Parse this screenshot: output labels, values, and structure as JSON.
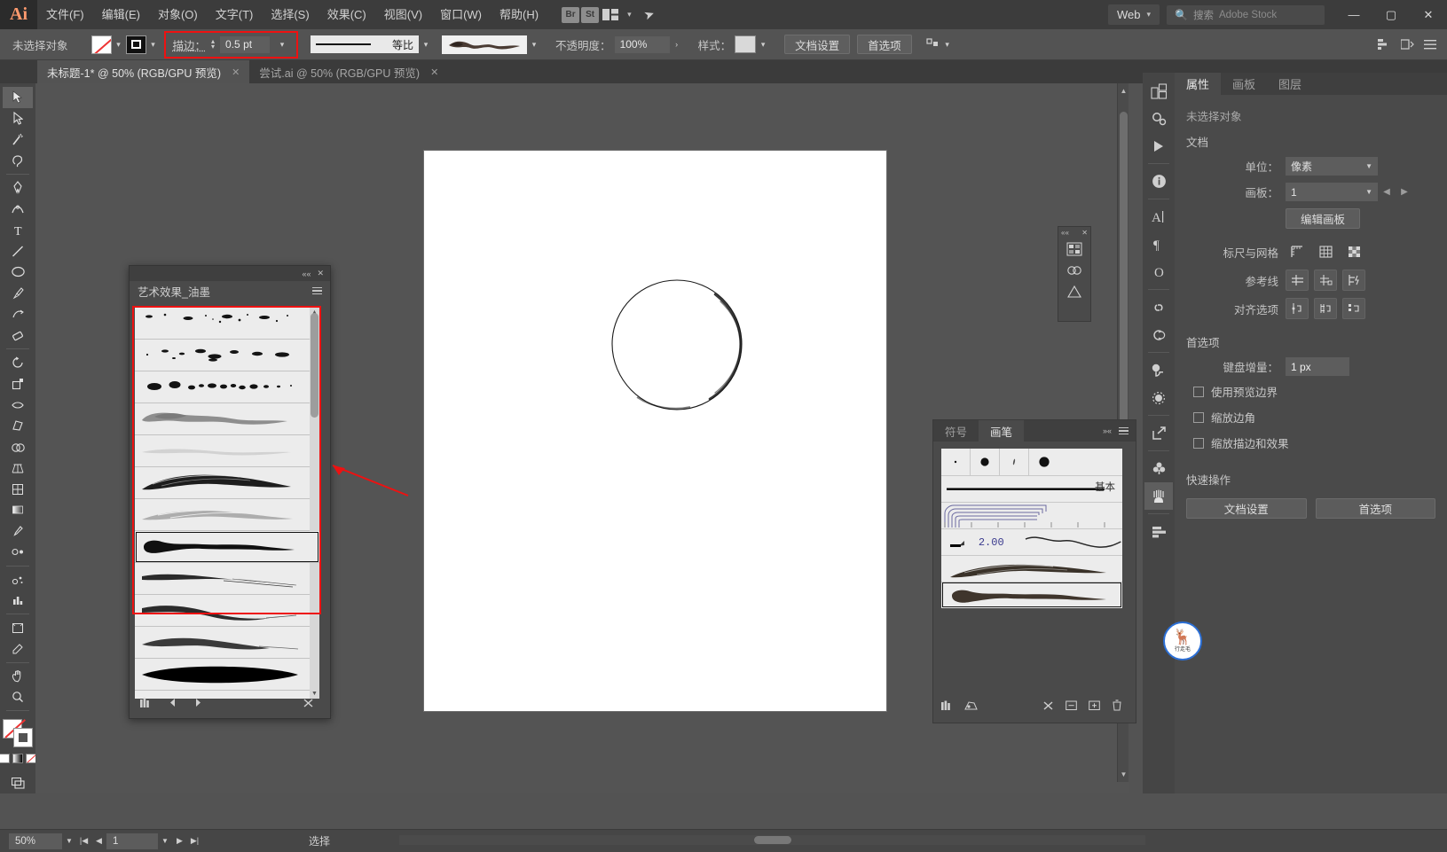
{
  "app": {
    "logo": "Ai",
    "title": "Adobe Illustrator"
  },
  "menubar": {
    "items": [
      {
        "label": "文件(F)"
      },
      {
        "label": "编辑(E)"
      },
      {
        "label": "对象(O)"
      },
      {
        "label": "文字(T)"
      },
      {
        "label": "选择(S)"
      },
      {
        "label": "效果(C)"
      },
      {
        "label": "视图(V)"
      },
      {
        "label": "窗口(W)"
      },
      {
        "label": "帮助(H)"
      }
    ],
    "bridge_label": "Br",
    "stock_label": "St",
    "workspace": "Web",
    "search_placeholder": "搜索 Adobe Stock",
    "search_label": "搜索",
    "search_hint": "Adobe Stock",
    "window_minimize": "—",
    "window_maximize": "▢",
    "window_close": "✕"
  },
  "controlbar": {
    "selection_status": "未选择对象",
    "stroke_label": "描边：",
    "stroke_weight": "0.5 pt",
    "profile_label": "等比",
    "opacity_label": "不透明度：",
    "opacity_value": "100%",
    "style_label": "样式：",
    "doc_setup": "文档设置",
    "preferences": "首选项",
    "highlight_color": "#ee1111"
  },
  "tabs": [
    {
      "label": "未标题-1* @ 50% (RGB/GPU 预览)",
      "active": true,
      "close": "✕"
    },
    {
      "label": "尝试.ai @ 50% (RGB/GPU 预览)",
      "active": false,
      "close": "✕"
    }
  ],
  "toolbar": {
    "tools": [
      {
        "name": "selection-tool"
      },
      {
        "name": "direct-selection-tool"
      },
      {
        "name": "magic-wand-tool"
      },
      {
        "name": "lasso-tool"
      },
      {
        "name": "pen-tool"
      },
      {
        "name": "curvature-tool"
      },
      {
        "name": "type-tool"
      },
      {
        "name": "line-segment-tool"
      },
      {
        "name": "ellipse-tool"
      },
      {
        "name": "paintbrush-tool"
      },
      {
        "name": "shaper-tool"
      },
      {
        "name": "eraser-tool"
      },
      {
        "name": "rotate-tool"
      },
      {
        "name": "scale-tool"
      },
      {
        "name": "width-tool"
      },
      {
        "name": "free-transform-tool"
      },
      {
        "name": "shape-builder-tool"
      },
      {
        "name": "perspective-grid-tool"
      },
      {
        "name": "mesh-tool"
      },
      {
        "name": "gradient-tool"
      },
      {
        "name": "eyedropper-tool"
      },
      {
        "name": "blend-tool"
      },
      {
        "name": "symbol-sprayer-tool"
      },
      {
        "name": "column-graph-tool"
      },
      {
        "name": "artboard-tool"
      },
      {
        "name": "slice-tool"
      },
      {
        "name": "hand-tool"
      },
      {
        "name": "zoom-tool"
      }
    ]
  },
  "canvas": {
    "artboard_background": "#ffffff",
    "shape": "circle-with-ink-brush-stroke"
  },
  "brush_library_panel": {
    "title": "艺术效果_油墨",
    "collapse": "««",
    "close": "✕",
    "menu": "menu",
    "brushes": [
      {
        "name": "ink-splatter-1",
        "style": "splatter-small"
      },
      {
        "name": "ink-splatter-2",
        "style": "splatter-dots"
      },
      {
        "name": "ink-splatter-3",
        "style": "splatter-blobs"
      },
      {
        "name": "ink-wash-gray",
        "style": "wash-gray"
      },
      {
        "name": "ink-wash-light",
        "style": "wash-light"
      },
      {
        "name": "ink-dry-brush-dark",
        "style": "dry-brush-dark"
      },
      {
        "name": "ink-dry-brush-light",
        "style": "dry-brush-light"
      },
      {
        "name": "ink-thick-tapered",
        "style": "thick-tapered",
        "selected": true
      },
      {
        "name": "ink-stroke-fade-1",
        "style": "stroke-fade"
      },
      {
        "name": "ink-stroke-wave",
        "style": "stroke-wave"
      },
      {
        "name": "ink-stroke-fade-2",
        "style": "stroke-fade2"
      },
      {
        "name": "ink-solid-lens",
        "style": "solid-lens"
      },
      {
        "name": "ink-solid-taper",
        "style": "solid-taper"
      },
      {
        "name": "ink-solid-wedge",
        "style": "solid-wedge"
      }
    ],
    "footer_icons": [
      "library-icon",
      "prev-icon",
      "next-icon",
      "delete-icon"
    ],
    "annotation_box_color": "#ee1111"
  },
  "brushes_panel": {
    "tabs": [
      {
        "label": "符号",
        "active": false
      },
      {
        "label": "画笔",
        "active": true
      }
    ],
    "basic_label": "基本",
    "calligraphic": [
      {
        "name": "calligraphic-1pt"
      },
      {
        "name": "calligraphic-3pt"
      },
      {
        "name": "calligraphic-5pt"
      },
      {
        "name": "calligraphic-10pt"
      }
    ],
    "items": [
      {
        "name": "basic-stroke",
        "label": "基本"
      },
      {
        "name": "pattern-brush-border"
      },
      {
        "name": "scatter-brush",
        "label": "2.00"
      },
      {
        "name": "art-brush-dry"
      },
      {
        "name": "art-brush-ink-selected",
        "selected": true
      }
    ],
    "footer_icons": [
      "library-icon",
      "brush-libraries-icon",
      "remove-brush-icon",
      "options-icon",
      "new-brush-icon",
      "delete-icon"
    ]
  },
  "mini_panel": {
    "collapse": "««",
    "close": "✕",
    "buttons": [
      "swatches-icon",
      "color-guide-icon",
      "transparency-icon"
    ]
  },
  "right_rail": {
    "items": [
      {
        "name": "libraries-icon"
      },
      {
        "name": "properties-icon"
      },
      {
        "name": "actions-icon"
      },
      {
        "name": "info-icon"
      },
      {
        "name": "character-icon"
      },
      {
        "name": "paragraph-icon"
      },
      {
        "name": "glyphs-icon"
      },
      {
        "name": "links-icon"
      },
      {
        "name": "cc-libraries-icon"
      },
      {
        "name": "pathfinder-icon"
      },
      {
        "name": "transparency-icon"
      },
      {
        "name": "asset-export-icon"
      },
      {
        "name": "symbols-icon"
      },
      {
        "name": "brushes-icon"
      },
      {
        "name": "align-icon"
      }
    ]
  },
  "properties_panel": {
    "tabs": [
      {
        "label": "属性",
        "active": true
      },
      {
        "label": "画板",
        "active": false
      },
      {
        "label": "图层",
        "active": false
      }
    ],
    "no_selection": "未选择对象",
    "document_section": "文档",
    "units_label": "单位：",
    "units_value": "像素",
    "artboard_label": "画板：",
    "artboard_value": "1",
    "edit_artboards": "编辑画板",
    "rulers_grid_label": "标尺与网格",
    "rulers_icons": [
      "rulers-icon",
      "grid-icon",
      "transparency-grid-icon"
    ],
    "guides_label": "参考线",
    "guides_icons": [
      "show-guides-icon",
      "lock-guides-icon",
      "smart-guides-icon"
    ],
    "snap_label": "对齐选项",
    "snap_icons": [
      "snap-to-point-icon",
      "snap-to-grid-icon",
      "snap-to-pixel-icon"
    ],
    "prefs_section": "首选项",
    "keyboard_increment_label": "键盘增量：",
    "keyboard_increment_value": "1 px",
    "checkboxes": [
      {
        "label": "使用预览边界",
        "checked": false
      },
      {
        "label": "缩放边角",
        "checked": false
      },
      {
        "label": "缩放描边和效果",
        "checked": false
      }
    ],
    "quick_actions_label": "快速操作",
    "quick_actions": [
      {
        "label": "文档设置"
      },
      {
        "label": "首选项"
      }
    ]
  },
  "statusbar": {
    "zoom": "50%",
    "page": "1",
    "status_text": "选择",
    "screen_mode_icon": "screen-mode-icon"
  },
  "watermark": {
    "text": "行走毛",
    "glyph": "🦌",
    "ring_color": "#2b6fd6"
  }
}
